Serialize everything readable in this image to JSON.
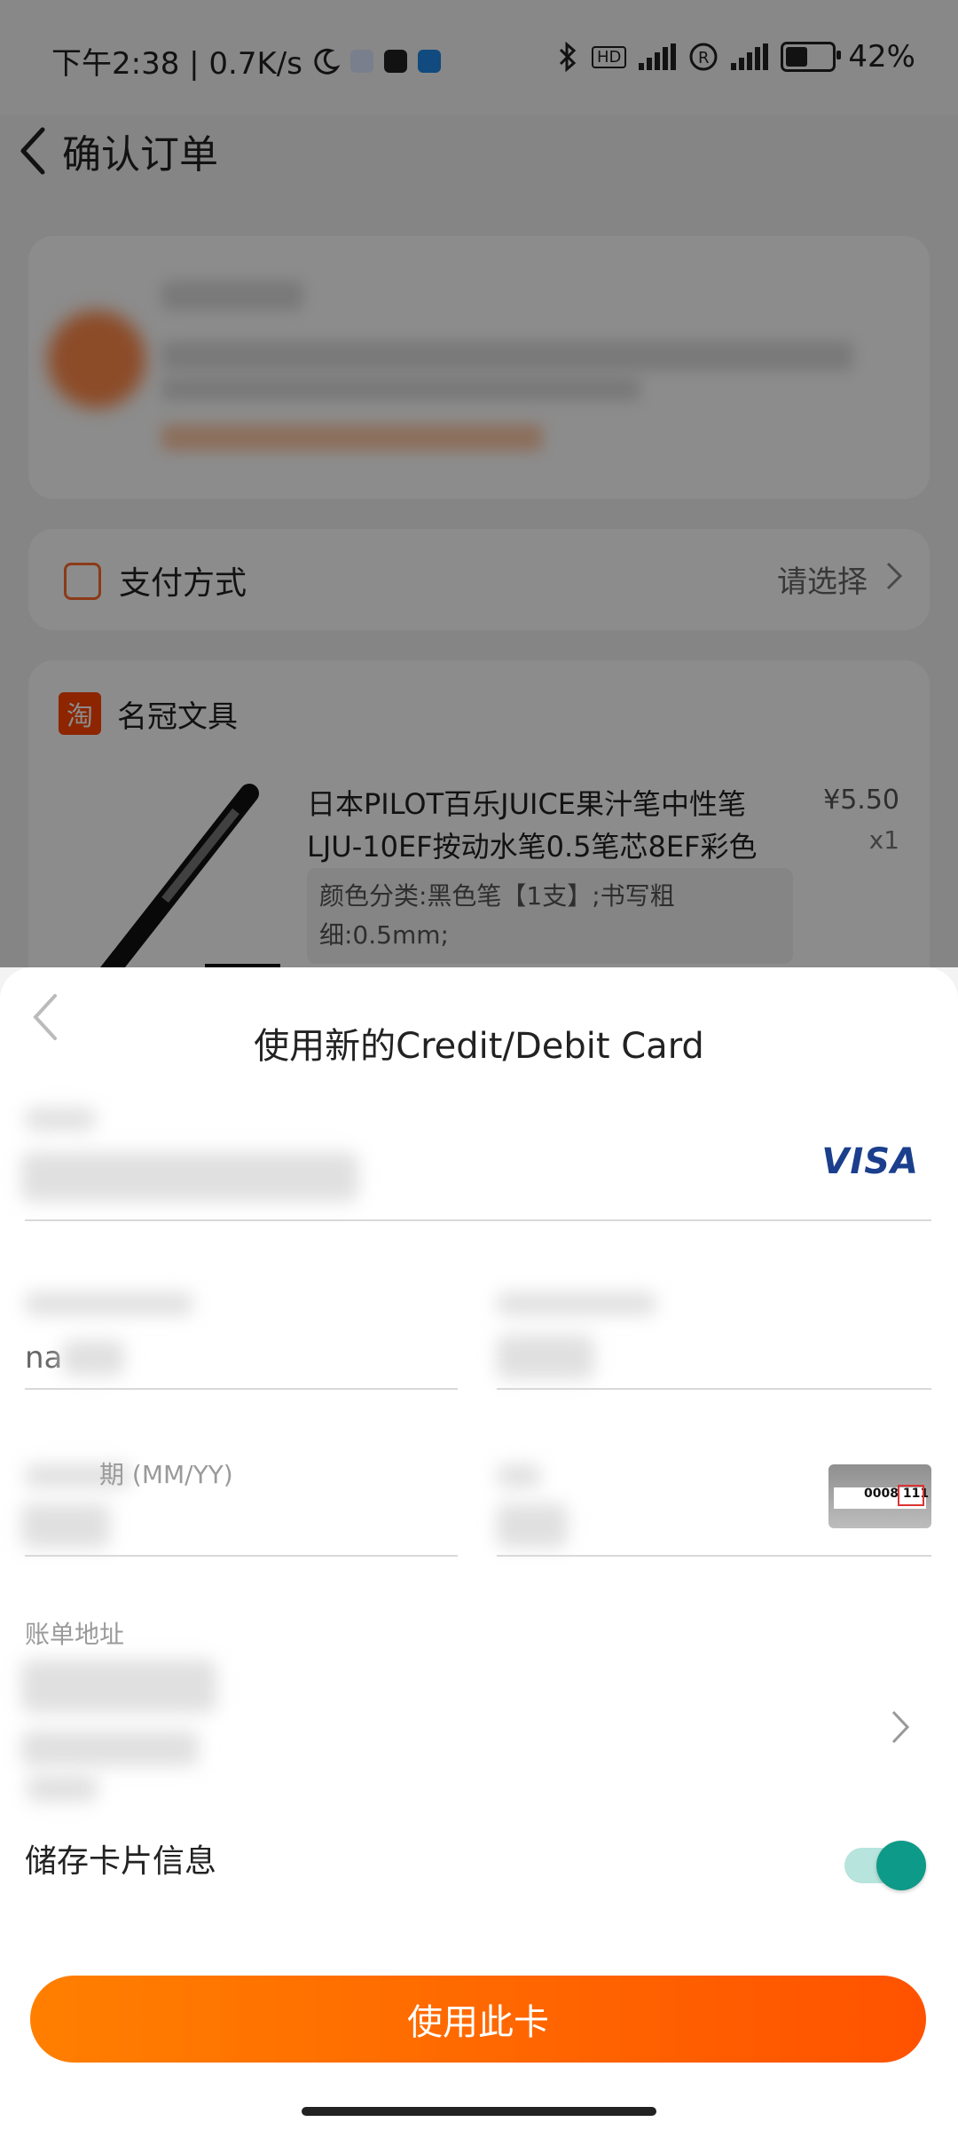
{
  "status_bar": {
    "time_speed": "下午2:38 | 0.7K/s",
    "battery": "42%"
  },
  "header": {
    "title": "确认订单"
  },
  "payment": {
    "label": "支付方式",
    "select": "请选择"
  },
  "shop": {
    "badge": "淘",
    "name": "名冠文具",
    "product_title": "日本PILOT百乐JUICE果汁笔中性笔LJU-10EF按动水笔0.5笔芯8EF彩色",
    "price": "¥5.50",
    "qty": "x1",
    "spec": "颜色分类:黑色笔【1支】;书写粗细:0.5mm;"
  },
  "sheet": {
    "title": "使用新的Credit/Debit Card",
    "card_brand": "VISA",
    "name_value": "na",
    "expiry_label": "期 (MM/YY)",
    "cvv_sample": "0008 111",
    "billing_label": "账单地址",
    "save_label": "储存卡片信息",
    "use_card_button": "使用此卡"
  },
  "colors": {
    "accent": "#ff6a00",
    "toggle": "#0e9a88",
    "visa": "#1b3f8c"
  }
}
